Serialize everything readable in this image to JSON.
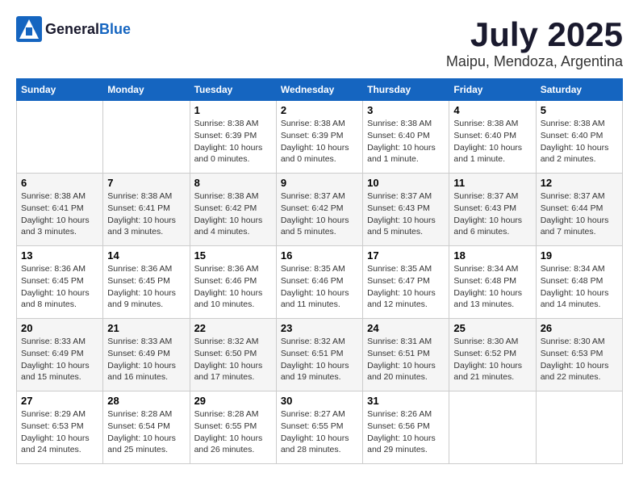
{
  "header": {
    "logo_general": "General",
    "logo_blue": "Blue",
    "month_year": "July 2025",
    "location": "Maipu, Mendoza, Argentina"
  },
  "days_of_week": [
    "Sunday",
    "Monday",
    "Tuesday",
    "Wednesday",
    "Thursday",
    "Friday",
    "Saturday"
  ],
  "weeks": [
    [
      {
        "day": "",
        "info": ""
      },
      {
        "day": "",
        "info": ""
      },
      {
        "day": "1",
        "info": "Sunrise: 8:38 AM\nSunset: 6:39 PM\nDaylight: 10 hours and 0 minutes."
      },
      {
        "day": "2",
        "info": "Sunrise: 8:38 AM\nSunset: 6:39 PM\nDaylight: 10 hours and 0 minutes."
      },
      {
        "day": "3",
        "info": "Sunrise: 8:38 AM\nSunset: 6:40 PM\nDaylight: 10 hours and 1 minute."
      },
      {
        "day": "4",
        "info": "Sunrise: 8:38 AM\nSunset: 6:40 PM\nDaylight: 10 hours and 1 minute."
      },
      {
        "day": "5",
        "info": "Sunrise: 8:38 AM\nSunset: 6:40 PM\nDaylight: 10 hours and 2 minutes."
      }
    ],
    [
      {
        "day": "6",
        "info": "Sunrise: 8:38 AM\nSunset: 6:41 PM\nDaylight: 10 hours and 3 minutes."
      },
      {
        "day": "7",
        "info": "Sunrise: 8:38 AM\nSunset: 6:41 PM\nDaylight: 10 hours and 3 minutes."
      },
      {
        "day": "8",
        "info": "Sunrise: 8:38 AM\nSunset: 6:42 PM\nDaylight: 10 hours and 4 minutes."
      },
      {
        "day": "9",
        "info": "Sunrise: 8:37 AM\nSunset: 6:42 PM\nDaylight: 10 hours and 5 minutes."
      },
      {
        "day": "10",
        "info": "Sunrise: 8:37 AM\nSunset: 6:43 PM\nDaylight: 10 hours and 5 minutes."
      },
      {
        "day": "11",
        "info": "Sunrise: 8:37 AM\nSunset: 6:43 PM\nDaylight: 10 hours and 6 minutes."
      },
      {
        "day": "12",
        "info": "Sunrise: 8:37 AM\nSunset: 6:44 PM\nDaylight: 10 hours and 7 minutes."
      }
    ],
    [
      {
        "day": "13",
        "info": "Sunrise: 8:36 AM\nSunset: 6:45 PM\nDaylight: 10 hours and 8 minutes."
      },
      {
        "day": "14",
        "info": "Sunrise: 8:36 AM\nSunset: 6:45 PM\nDaylight: 10 hours and 9 minutes."
      },
      {
        "day": "15",
        "info": "Sunrise: 8:36 AM\nSunset: 6:46 PM\nDaylight: 10 hours and 10 minutes."
      },
      {
        "day": "16",
        "info": "Sunrise: 8:35 AM\nSunset: 6:46 PM\nDaylight: 10 hours and 11 minutes."
      },
      {
        "day": "17",
        "info": "Sunrise: 8:35 AM\nSunset: 6:47 PM\nDaylight: 10 hours and 12 minutes."
      },
      {
        "day": "18",
        "info": "Sunrise: 8:34 AM\nSunset: 6:48 PM\nDaylight: 10 hours and 13 minutes."
      },
      {
        "day": "19",
        "info": "Sunrise: 8:34 AM\nSunset: 6:48 PM\nDaylight: 10 hours and 14 minutes."
      }
    ],
    [
      {
        "day": "20",
        "info": "Sunrise: 8:33 AM\nSunset: 6:49 PM\nDaylight: 10 hours and 15 minutes."
      },
      {
        "day": "21",
        "info": "Sunrise: 8:33 AM\nSunset: 6:49 PM\nDaylight: 10 hours and 16 minutes."
      },
      {
        "day": "22",
        "info": "Sunrise: 8:32 AM\nSunset: 6:50 PM\nDaylight: 10 hours and 17 minutes."
      },
      {
        "day": "23",
        "info": "Sunrise: 8:32 AM\nSunset: 6:51 PM\nDaylight: 10 hours and 19 minutes."
      },
      {
        "day": "24",
        "info": "Sunrise: 8:31 AM\nSunset: 6:51 PM\nDaylight: 10 hours and 20 minutes."
      },
      {
        "day": "25",
        "info": "Sunrise: 8:30 AM\nSunset: 6:52 PM\nDaylight: 10 hours and 21 minutes."
      },
      {
        "day": "26",
        "info": "Sunrise: 8:30 AM\nSunset: 6:53 PM\nDaylight: 10 hours and 22 minutes."
      }
    ],
    [
      {
        "day": "27",
        "info": "Sunrise: 8:29 AM\nSunset: 6:53 PM\nDaylight: 10 hours and 24 minutes."
      },
      {
        "day": "28",
        "info": "Sunrise: 8:28 AM\nSunset: 6:54 PM\nDaylight: 10 hours and 25 minutes."
      },
      {
        "day": "29",
        "info": "Sunrise: 8:28 AM\nSunset: 6:55 PM\nDaylight: 10 hours and 26 minutes."
      },
      {
        "day": "30",
        "info": "Sunrise: 8:27 AM\nSunset: 6:55 PM\nDaylight: 10 hours and 28 minutes."
      },
      {
        "day": "31",
        "info": "Sunrise: 8:26 AM\nSunset: 6:56 PM\nDaylight: 10 hours and 29 minutes."
      },
      {
        "day": "",
        "info": ""
      },
      {
        "day": "",
        "info": ""
      }
    ]
  ]
}
